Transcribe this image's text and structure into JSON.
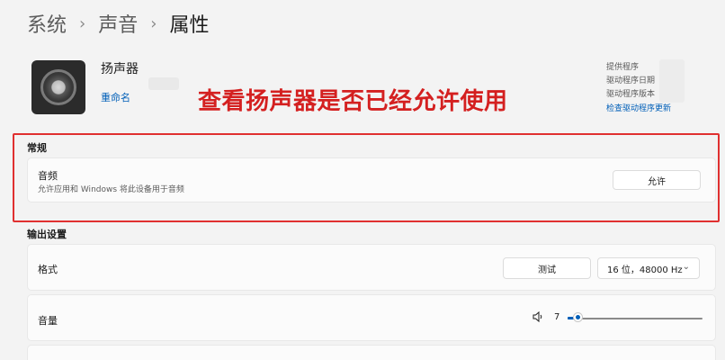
{
  "breadcrumb": {
    "items": [
      "系统",
      "声音",
      "属性"
    ],
    "separator": "›"
  },
  "device": {
    "name": "扬声器",
    "rename_link": "重命名",
    "icon": "speaker-icon"
  },
  "annotation": "查看扬声器是否已经允许使用",
  "driver_info": {
    "provider_label": "提供程序",
    "date_label": "驱动程序日期",
    "version_label": "驱动程序版本",
    "update_link": "检查驱动程序更新"
  },
  "general": {
    "section_title": "常规",
    "audio_title": "音频",
    "audio_desc": "允许应用和 Windows 将此设备用于音频",
    "allow_button": "允许"
  },
  "output": {
    "section_title": "输出设置",
    "format_label": "格式",
    "test_button": "测试",
    "format_value": "16 位，48000 Hz",
    "volume_label": "音量",
    "volume_value": "7",
    "volume_level": 0.07
  },
  "colors": {
    "accent": "#005fb8",
    "annotation": "#d42020",
    "highlight_border": "#e03030"
  }
}
